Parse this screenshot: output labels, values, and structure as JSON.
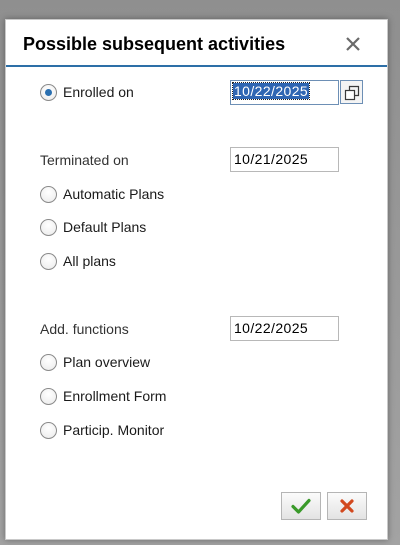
{
  "dialog": {
    "title": "Possible subsequent activities",
    "close_icon": "close-icon"
  },
  "enrolled": {
    "label": "Enrolled on",
    "selected": true,
    "date": "10/22/2025",
    "picker_icon": "date-picker-icon"
  },
  "terminated": {
    "section_label": "Terminated on",
    "date": "10/21/2025",
    "options": [
      {
        "label": "Automatic Plans",
        "selected": false
      },
      {
        "label": "Default Plans",
        "selected": false
      },
      {
        "label": "All plans",
        "selected": false
      }
    ]
  },
  "functions": {
    "section_label": "Add. functions",
    "date": "10/22/2025",
    "options": [
      {
        "label": "Plan overview",
        "selected": false
      },
      {
        "label": "Enrollment Form",
        "selected": false
      },
      {
        "label": "Particip. Monitor",
        "selected": false
      }
    ]
  },
  "footer": {
    "confirm_icon": "checkmark-icon",
    "cancel_icon": "cancel-icon"
  },
  "colors": {
    "accent": "#2d6fa7",
    "selection": "#2f66b3",
    "confirm": "#3a9a2a",
    "cancel": "#d2491f"
  }
}
